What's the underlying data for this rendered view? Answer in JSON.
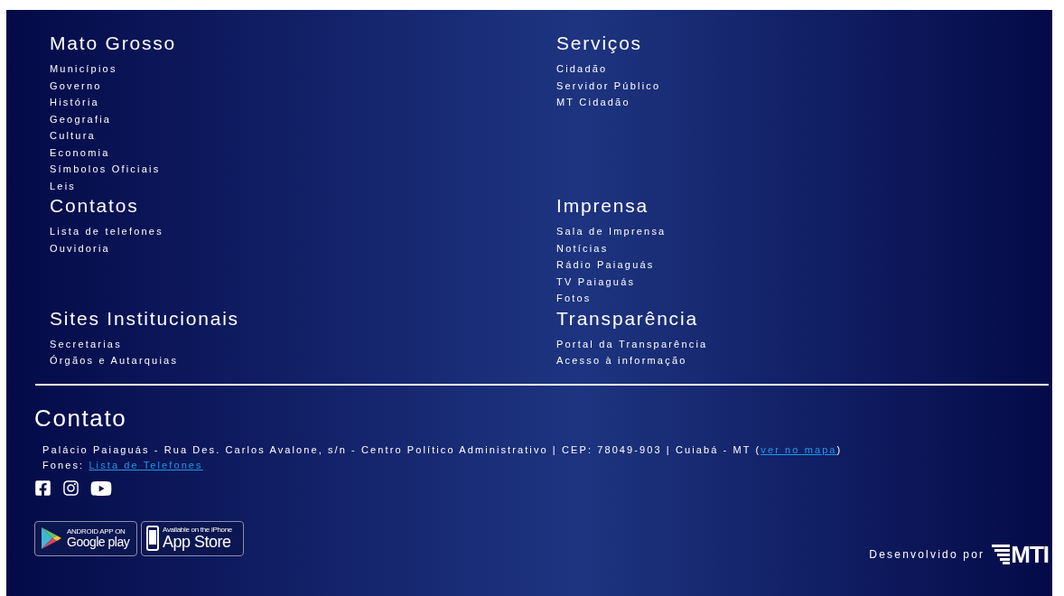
{
  "sections": [
    {
      "title": "Mato Grosso",
      "links": [
        "Municípios",
        "Governo",
        "História",
        "Geografia",
        "Cultura",
        "Economia",
        "Símbolos Oficiais",
        "Leis"
      ]
    },
    {
      "title": "Serviços",
      "links": [
        "Cidadão",
        "Servidor Público",
        "MT Cidadão"
      ]
    },
    {
      "title": "Contatos",
      "links": [
        "Lista de telefones",
        "Ouvidoria"
      ]
    },
    {
      "title": "Imprensa",
      "links": [
        "Sala de Imprensa",
        "Notícias",
        "Rádio Paiaguás",
        "TV Paiaguás",
        "Fotos"
      ]
    },
    {
      "title": "Sites Institucionais",
      "links": [
        "Secretarias",
        "Órgãos e Autarquias"
      ]
    },
    {
      "title": "Transparência",
      "links": [
        "Portal da Transparência",
        "Acesso à informação"
      ]
    }
  ],
  "contact": {
    "title": "Contato",
    "address": "Palácio Paiaguás - Rua Des. Carlos Avalone, s/n - Centro Político Administrativo | CEP: 78049-903 | Cuiabá - MT (",
    "map_link": "ver no mapa",
    "address_end": ")",
    "phones_label": "Fones:",
    "phones_link": "Lista de Telefones"
  },
  "social": [
    {
      "kind": "facebook"
    },
    {
      "kind": "instagram"
    },
    {
      "kind": "youtube"
    }
  ],
  "app_badges": [
    {
      "kind": "google-play",
      "caption": "ANDROID APP ON",
      "label": "Google play"
    },
    {
      "kind": "app-store",
      "caption": "Available on the iPhone",
      "label": "App Store"
    }
  ],
  "credit": {
    "text": "Desenvolvido por",
    "logo": "MTI"
  }
}
